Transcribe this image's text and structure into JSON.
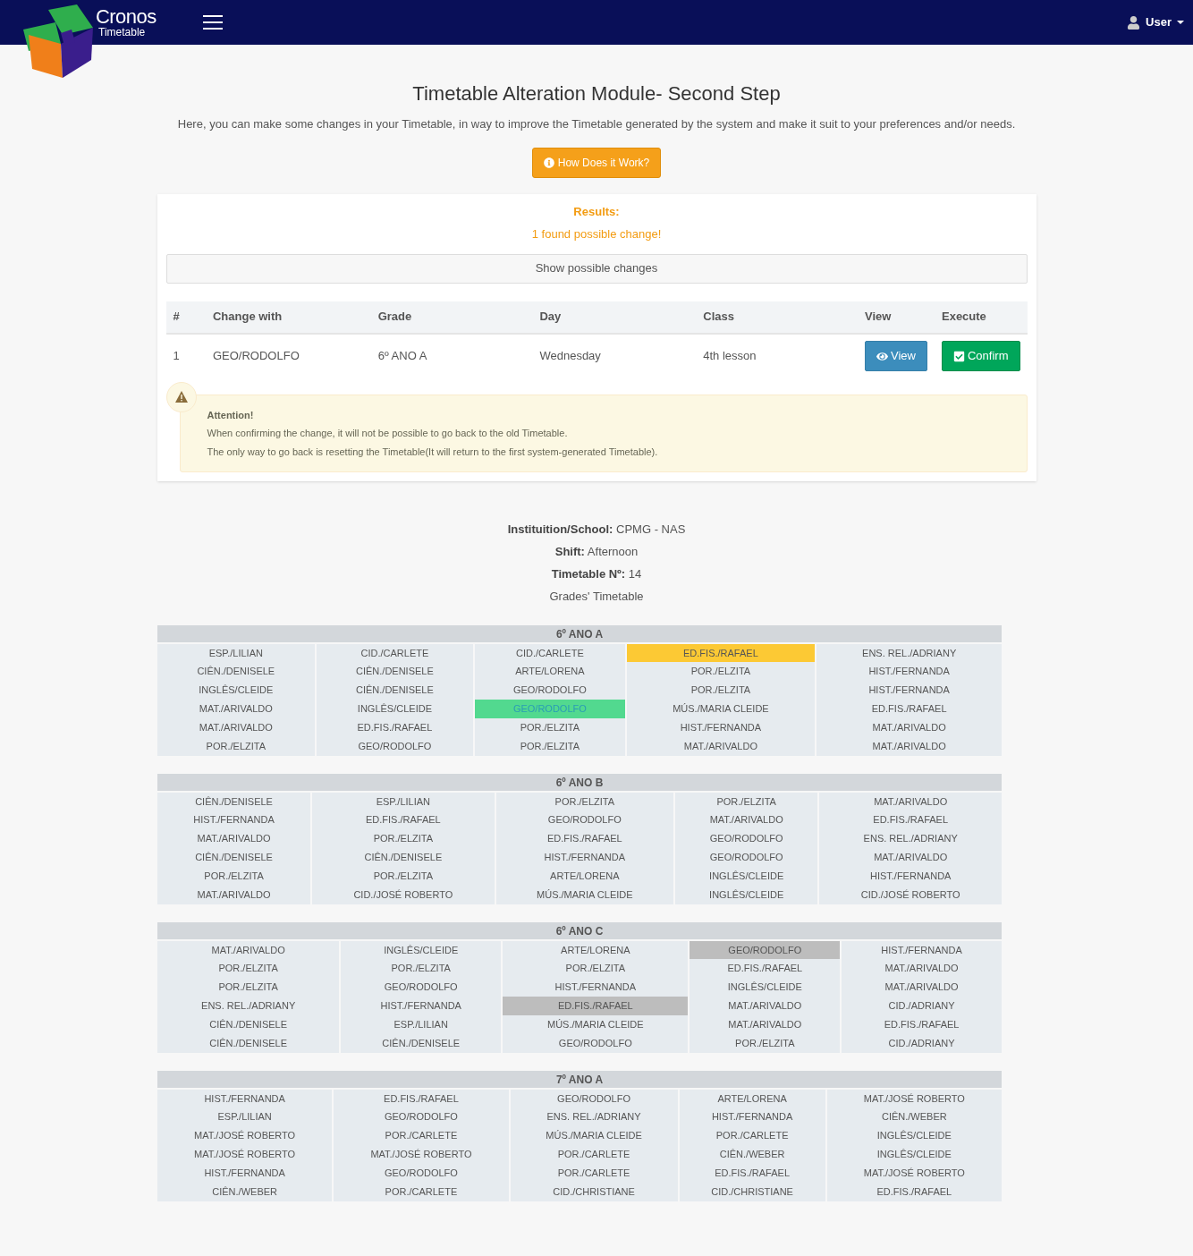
{
  "header": {
    "brand_name": "Cronos",
    "brand_subtitle": "Timetable",
    "user_menu": "User"
  },
  "page": {
    "title": "Timetable Alteration Module- Second Step",
    "description": "Here, you can make some changes in your Timetable, in way to improve the Timetable generated by the system and make it suit to your preferences and/or needs.",
    "help_button": "How Does it Work?"
  },
  "results": {
    "title": "Results:",
    "message": "1 found possible change!",
    "toggle_button": "Show possible changes",
    "columns": [
      "#",
      "Change with",
      "Grade",
      "Day",
      "Class",
      "View",
      "Execute"
    ],
    "rows": [
      {
        "cells": [
          "1",
          "GEO/RODOLFO",
          "6º ANO A",
          "Wednesday",
          "4th lesson"
        ],
        "view_button": "View",
        "confirm_button": "Confirm"
      }
    ]
  },
  "alert": {
    "title": "Attention!",
    "lines": [
      "When confirming the change, it will not be possible to go back to the old Timetable.",
      "The only way to go back is resetting the Timetable(It will return to the first system-generated Timetable)."
    ]
  },
  "info": [
    {
      "label": "Instituition/School:",
      "value": "CPMG - NAS"
    },
    {
      "label": "Shift:",
      "value": "Afternoon"
    },
    {
      "label": "Timetable Nº:",
      "value": "14"
    }
  ],
  "info_subtitle": "Grades' Timetable",
  "timetables": [
    {
      "grade": "6º ANO A",
      "days": [
        [
          {
            "text": "ESP./LILIAN",
            "color": "#e6ebef"
          },
          {
            "text": "CIÊN./DENISELE",
            "color": "#e6ebef"
          },
          {
            "text": "INGLÊS/CLEIDE",
            "color": "#e6ebef"
          },
          {
            "text": "MAT./ARIVALDO",
            "color": "#e6ebef"
          },
          {
            "text": "MAT./ARIVALDO",
            "color": "#e6ebef"
          },
          {
            "text": "POR./ELZITA",
            "color": "#e6ebef"
          }
        ],
        [
          {
            "text": "CID./CARLETE",
            "color": "#e6ebef"
          },
          {
            "text": "CIÊN./DENISELE",
            "color": "#e6ebef"
          },
          {
            "text": "CIÊN./DENISELE",
            "color": "#e6ebef"
          },
          {
            "text": "INGLÊS/CLEIDE",
            "color": "#e6ebef"
          },
          {
            "text": "ED.FIS./RAFAEL",
            "color": "#e6ebef"
          },
          {
            "text": "GEO/RODOLFO",
            "color": "#e6ebef"
          }
        ],
        [
          {
            "text": "CID./CARLETE",
            "color": "#e6ebef"
          },
          {
            "text": "ARTE/LORENA",
            "color": "#e6ebef"
          },
          {
            "text": "GEO/RODOLFO",
            "color": "#e6ebef"
          },
          {
            "text": "GEO/RODOLFO",
            "color": "#52d98f"
          },
          {
            "text": "POR./ELZITA",
            "color": "#e6ebef"
          },
          {
            "text": "POR./ELZITA",
            "color": "#e6ebef"
          }
        ],
        [
          {
            "text": "ED.FIS./RAFAEL",
            "color": "#fcc934"
          },
          {
            "text": "POR./ELZITA",
            "color": "#e6ebef"
          },
          {
            "text": "POR./ELZITA",
            "color": "#e6ebef"
          },
          {
            "text": "MÚS./MARIA CLEIDE",
            "color": "#e6ebef"
          },
          {
            "text": "HIST./FERNANDA",
            "color": "#e6ebef"
          },
          {
            "text": "MAT./ARIVALDO",
            "color": "#e6ebef"
          }
        ],
        [
          {
            "text": "ENS. REL./ADRIANY",
            "color": "#e6ebef"
          },
          {
            "text": "HIST./FERNANDA",
            "color": "#e6ebef"
          },
          {
            "text": "HIST./FERNANDA",
            "color": "#e6ebef"
          },
          {
            "text": "ED.FIS./RAFAEL",
            "color": "#e6ebef"
          },
          {
            "text": "MAT./ARIVALDO",
            "color": "#e6ebef"
          },
          {
            "text": "MAT./ARIVALDO",
            "color": "#e6ebef"
          }
        ]
      ]
    },
    {
      "grade": "6º ANO B",
      "days": [
        [
          {
            "text": "CIÊN./DENISELE",
            "color": "#e6ebef"
          },
          {
            "text": "HIST./FERNANDA",
            "color": "#e6ebef"
          },
          {
            "text": "MAT./ARIVALDO",
            "color": "#e6ebef"
          },
          {
            "text": "CIÊN./DENISELE",
            "color": "#e6ebef"
          },
          {
            "text": "POR./ELZITA",
            "color": "#e6ebef"
          },
          {
            "text": "MAT./ARIVALDO",
            "color": "#e6ebef"
          }
        ],
        [
          {
            "text": "ESP./LILIAN",
            "color": "#e6ebef"
          },
          {
            "text": "ED.FIS./RAFAEL",
            "color": "#e6ebef"
          },
          {
            "text": "POR./ELZITA",
            "color": "#e6ebef"
          },
          {
            "text": "CIÊN./DENISELE",
            "color": "#e6ebef"
          },
          {
            "text": "POR./ELZITA",
            "color": "#e6ebef"
          },
          {
            "text": "CID./JOSÉ ROBERTO",
            "color": "#e6ebef"
          }
        ],
        [
          {
            "text": "POR./ELZITA",
            "color": "#e6ebef"
          },
          {
            "text": "GEO/RODOLFO",
            "color": "#e6ebef"
          },
          {
            "text": "ED.FIS./RAFAEL",
            "color": "#e6ebef"
          },
          {
            "text": "HIST./FERNANDA",
            "color": "#e6ebef"
          },
          {
            "text": "ARTE/LORENA",
            "color": "#e6ebef"
          },
          {
            "text": "MÚS./MARIA CLEIDE",
            "color": "#e6ebef"
          }
        ],
        [
          {
            "text": "POR./ELZITA",
            "color": "#e6ebef"
          },
          {
            "text": "MAT./ARIVALDO",
            "color": "#e6ebef"
          },
          {
            "text": "GEO/RODOLFO",
            "color": "#e6ebef"
          },
          {
            "text": "GEO/RODOLFO",
            "color": "#e6ebef"
          },
          {
            "text": "INGLÊS/CLEIDE",
            "color": "#e6ebef"
          },
          {
            "text": "INGLÊS/CLEIDE",
            "color": "#e6ebef"
          }
        ],
        [
          {
            "text": "MAT./ARIVALDO",
            "color": "#e6ebef"
          },
          {
            "text": "ED.FIS./RAFAEL",
            "color": "#e6ebef"
          },
          {
            "text": "ENS. REL./ADRIANY",
            "color": "#e6ebef"
          },
          {
            "text": "MAT./ARIVALDO",
            "color": "#e6ebef"
          },
          {
            "text": "HIST./FERNANDA",
            "color": "#e6ebef"
          },
          {
            "text": "CID./JOSÉ ROBERTO",
            "color": "#e6ebef"
          }
        ]
      ]
    },
    {
      "grade": "6º ANO C",
      "days": [
        [
          {
            "text": "MAT./ARIVALDO",
            "color": "#e6ebef"
          },
          {
            "text": "POR./ELZITA",
            "color": "#e6ebef"
          },
          {
            "text": "POR./ELZITA",
            "color": "#e6ebef"
          },
          {
            "text": "ENS. REL./ADRIANY",
            "color": "#e6ebef"
          },
          {
            "text": "CIÊN./DENISELE",
            "color": "#e6ebef"
          },
          {
            "text": "CIÊN./DENISELE",
            "color": "#e6ebef"
          }
        ],
        [
          {
            "text": "INGLÊS/CLEIDE",
            "color": "#e6ebef"
          },
          {
            "text": "POR./ELZITA",
            "color": "#e6ebef"
          },
          {
            "text": "GEO/RODOLFO",
            "color": "#e6ebef"
          },
          {
            "text": "HIST./FERNANDA",
            "color": "#e6ebef"
          },
          {
            "text": "ESP./LILIAN",
            "color": "#e6ebef"
          },
          {
            "text": "CIÊN./DENISELE",
            "color": "#e6ebef"
          }
        ],
        [
          {
            "text": "ARTE/LORENA",
            "color": "#e6ebef"
          },
          {
            "text": "POR./ELZITA",
            "color": "#e6ebef"
          },
          {
            "text": "HIST./FERNANDA",
            "color": "#e6ebef"
          },
          {
            "text": "ED.FIS./RAFAEL",
            "color": "#bdbdbd"
          },
          {
            "text": "MÚS./MARIA CLEIDE",
            "color": "#e6ebef"
          },
          {
            "text": "GEO/RODOLFO",
            "color": "#e6ebef"
          }
        ],
        [
          {
            "text": "GEO/RODOLFO",
            "color": "#bdbdbd"
          },
          {
            "text": "ED.FIS./RAFAEL",
            "color": "#e6ebef"
          },
          {
            "text": "INGLÊS/CLEIDE",
            "color": "#e6ebef"
          },
          {
            "text": "MAT./ARIVALDO",
            "color": "#e6ebef"
          },
          {
            "text": "MAT./ARIVALDO",
            "color": "#e6ebef"
          },
          {
            "text": "POR./ELZITA",
            "color": "#e6ebef"
          }
        ],
        [
          {
            "text": "HIST./FERNANDA",
            "color": "#e6ebef"
          },
          {
            "text": "MAT./ARIVALDO",
            "color": "#e6ebef"
          },
          {
            "text": "MAT./ARIVALDO",
            "color": "#e6ebef"
          },
          {
            "text": "CID./ADRIANY",
            "color": "#e6ebef"
          },
          {
            "text": "ED.FIS./RAFAEL",
            "color": "#e6ebef"
          },
          {
            "text": "CID./ADRIANY",
            "color": "#e6ebef"
          }
        ]
      ]
    },
    {
      "grade": "7º ANO A",
      "days": [
        [
          {
            "text": "HIST./FERNANDA",
            "color": "#e6ebef"
          },
          {
            "text": "ESP./LILIAN",
            "color": "#e6ebef"
          },
          {
            "text": "MAT./JOSÉ ROBERTO",
            "color": "#e6ebef"
          },
          {
            "text": "MAT./JOSÉ ROBERTO",
            "color": "#e6ebef"
          },
          {
            "text": "HIST./FERNANDA",
            "color": "#e6ebef"
          },
          {
            "text": "CIÊN./WEBER",
            "color": "#e6ebef"
          }
        ],
        [
          {
            "text": "ED.FIS./RAFAEL",
            "color": "#e6ebef"
          },
          {
            "text": "GEO/RODOLFO",
            "color": "#e6ebef"
          },
          {
            "text": "POR./CARLETE",
            "color": "#e6ebef"
          },
          {
            "text": "MAT./JOSÉ ROBERTO",
            "color": "#e6ebef"
          },
          {
            "text": "GEO/RODOLFO",
            "color": "#e6ebef"
          },
          {
            "text": "POR./CARLETE",
            "color": "#e6ebef"
          }
        ],
        [
          {
            "text": "GEO/RODOLFO",
            "color": "#e6ebef"
          },
          {
            "text": "ENS. REL./ADRIANY",
            "color": "#e6ebef"
          },
          {
            "text": "MÚS./MARIA CLEIDE",
            "color": "#e6ebef"
          },
          {
            "text": "POR./CARLETE",
            "color": "#e6ebef"
          },
          {
            "text": "POR./CARLETE",
            "color": "#e6ebef"
          },
          {
            "text": "CID./CHRISTIANE",
            "color": "#e6ebef"
          }
        ],
        [
          {
            "text": "ARTE/LORENA",
            "color": "#e6ebef"
          },
          {
            "text": "HIST./FERNANDA",
            "color": "#e6ebef"
          },
          {
            "text": "POR./CARLETE",
            "color": "#e6ebef"
          },
          {
            "text": "CIÊN./WEBER",
            "color": "#e6ebef"
          },
          {
            "text": "ED.FIS./RAFAEL",
            "color": "#e6ebef"
          },
          {
            "text": "CID./CHRISTIANE",
            "color": "#e6ebef"
          }
        ],
        [
          {
            "text": "MAT./JOSÉ ROBERTO",
            "color": "#e6ebef"
          },
          {
            "text": "CIÊN./WEBER",
            "color": "#e6ebef"
          },
          {
            "text": "INGLÊS/CLEIDE",
            "color": "#e6ebef"
          },
          {
            "text": "INGLÊS/CLEIDE",
            "color": "#e6ebef"
          },
          {
            "text": "MAT./JOSÉ ROBERTO",
            "color": "#e6ebef"
          },
          {
            "text": "ED.FIS./RAFAEL",
            "color": "#e6ebef"
          }
        ]
      ]
    }
  ]
}
